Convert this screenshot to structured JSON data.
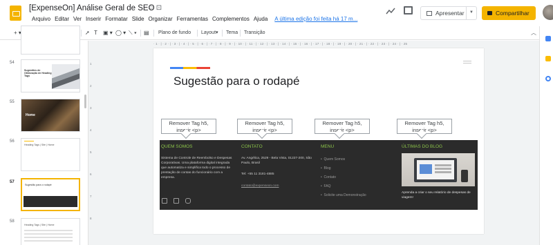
{
  "window": {
    "doc_title": "[ExpenseOn] Análise Geral de SEO",
    "title_icons": "☆ ⊡",
    "menu": [
      "Arquivo",
      "Editar",
      "Ver",
      "Inserir",
      "Formatar",
      "Slide",
      "Organizar",
      "Ferramentas",
      "Complementos",
      "Ajuda"
    ],
    "last_edit": "A última edição foi feita há 17 m...",
    "present_label": "Apresentar",
    "share_label": "Compartilhar"
  },
  "toolbar": {
    "background_label": "Plano de fundo",
    "layout_label": "Layout▾",
    "theme_label": "Tema",
    "transition_label": "Transição"
  },
  "filmstrip": {
    "slides": [
      {
        "number": "",
        "title": ""
      },
      {
        "number": "54",
        "title": "Sugestões de Otimização de Heading Tags"
      },
      {
        "number": "55",
        "title": "Home"
      },
      {
        "number": "56",
        "title": "Heading Tags | Site | Home"
      },
      {
        "number": "57",
        "title": "Sugestão para o rodapé"
      },
      {
        "number": "58",
        "title": "Heading Tags | Site | Home"
      }
    ]
  },
  "ruler": {
    "top": "· 1 · | · 2 · | · 3 · | · 4 · | · 5 · | · 6 · | · 7 · | · 8 · | · 9 · | · 10 · | · 11 · | · 12 · | · 13 · | · 14 · | · 15 · | · 16 · | · 17 · | · 18 · | · 19 · | · 20 · | · 21 · | · 22 · | · 23 · | · 24 · | · 25"
  },
  "slide": {
    "title": "Sugestão para o rodapé",
    "callouts": [
      "Remover Tag h5, inserir <p>",
      "Remover Tag h5, inserir <p>",
      "Remover Tag h5, inserir <p>",
      "Remover Tag h5, inserir <p>"
    ],
    "footer": {
      "about": {
        "heading": "QUEM SOMOS",
        "text": "Sistema de Controle de Reembolso e Despesas Corporativas. Uma plataforma digital integrada que automatiza e simplifica todo o processo de prestação de contas do funcionário com a empresa."
      },
      "contact": {
        "heading": "CONTATO",
        "address": "Av. Angélica, 2529 - Bela Vista, 01227-200, São Paulo, Brasil",
        "phone": "Tel: +55 11 3181-4885",
        "email": "contato@expenseon.com"
      },
      "menu": {
        "heading": "MENU",
        "items": [
          "Quem Somos",
          "Blog",
          "Contato",
          "FAQ",
          "Solicite uma Demonstração"
        ]
      },
      "blog": {
        "heading": "ÚLTIMAS DO BLOG",
        "caption": "Aprenda a criar o seu relatório de despesas de viagem!"
      }
    }
  },
  "colors": {
    "accent_yellow": "#f4b400",
    "footer_bg": "#2b2b2b",
    "footer_heading": "#8bc34a"
  }
}
